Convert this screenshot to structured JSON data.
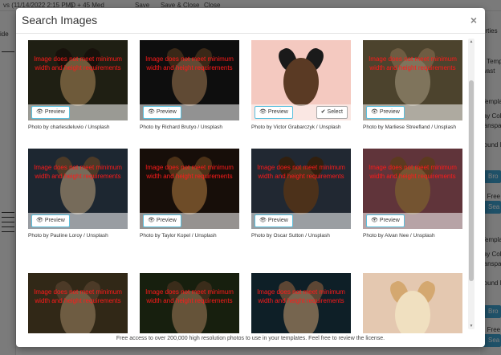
{
  "background": {
    "topbar_items": [
      "vs (11/14/2022 2:15 PM)",
      "ID + 45 Med",
      "Save",
      "Save & Close",
      "Close"
    ],
    "left_label": "ide",
    "right_items": [
      "erties",
      "it Templ",
      "wast",
      "Templa",
      "lay Colo",
      "ranspar",
      "round I",
      "Bro",
      "h Free",
      "Sea",
      "Templa",
      "lay Colo",
      "ranspar",
      "round I",
      "Bro",
      "h Free",
      "Sea"
    ]
  },
  "modal": {
    "title": "Search Images",
    "close_symbol": "×",
    "footer_text": "Free access to over 200,000 high resolution photos to use in your templates. Feel free to review the license.",
    "warning_text": "Image does not meet minimum width and height requirements",
    "preview_label": "Preview",
    "select_label": "Select"
  },
  "images": [
    {
      "credit": "Photo by charlesdeluvio / Unsplash",
      "too_small": true,
      "has_select": false,
      "bg": "#3a3a24"
    },
    {
      "credit": "Photo by Richard Brutyo / Unsplash",
      "too_small": true,
      "has_select": false,
      "bg": "#1a1a1a"
    },
    {
      "credit": "Photo by Victor Grabarczyk / Unsplash",
      "too_small": false,
      "has_select": true,
      "bg": "#f4c9c0"
    },
    {
      "credit": "Photo by Marliese Streefland / Unsplash",
      "too_small": true,
      "has_select": false,
      "bg": "#8a7a52"
    },
    {
      "credit": "Photo by Pauline Loroy / Unsplash",
      "too_small": true,
      "has_select": false,
      "bg": "#36485a"
    },
    {
      "credit": "Photo by Taylor Kopel / Unsplash",
      "too_small": true,
      "has_select": false,
      "bg": "#2a1a12"
    },
    {
      "credit": "Photo by Oscar Sutton / Unsplash",
      "too_small": true,
      "has_select": false,
      "bg": "#3c4a5c"
    },
    {
      "credit": "Photo by Alvan Nee / Unsplash",
      "too_small": true,
      "has_select": false,
      "bg": "#b0606a"
    },
    {
      "credit": "",
      "too_small": true,
      "has_select": false,
      "bg": "#5a4a2a"
    },
    {
      "credit": "",
      "too_small": true,
      "has_select": false,
      "bg": "#2a3a1a"
    },
    {
      "credit": "",
      "too_small": true,
      "has_select": false,
      "bg": "#1a3a48"
    },
    {
      "credit": "",
      "too_small": false,
      "has_select": false,
      "bg": "#e4c8b0"
    }
  ]
}
